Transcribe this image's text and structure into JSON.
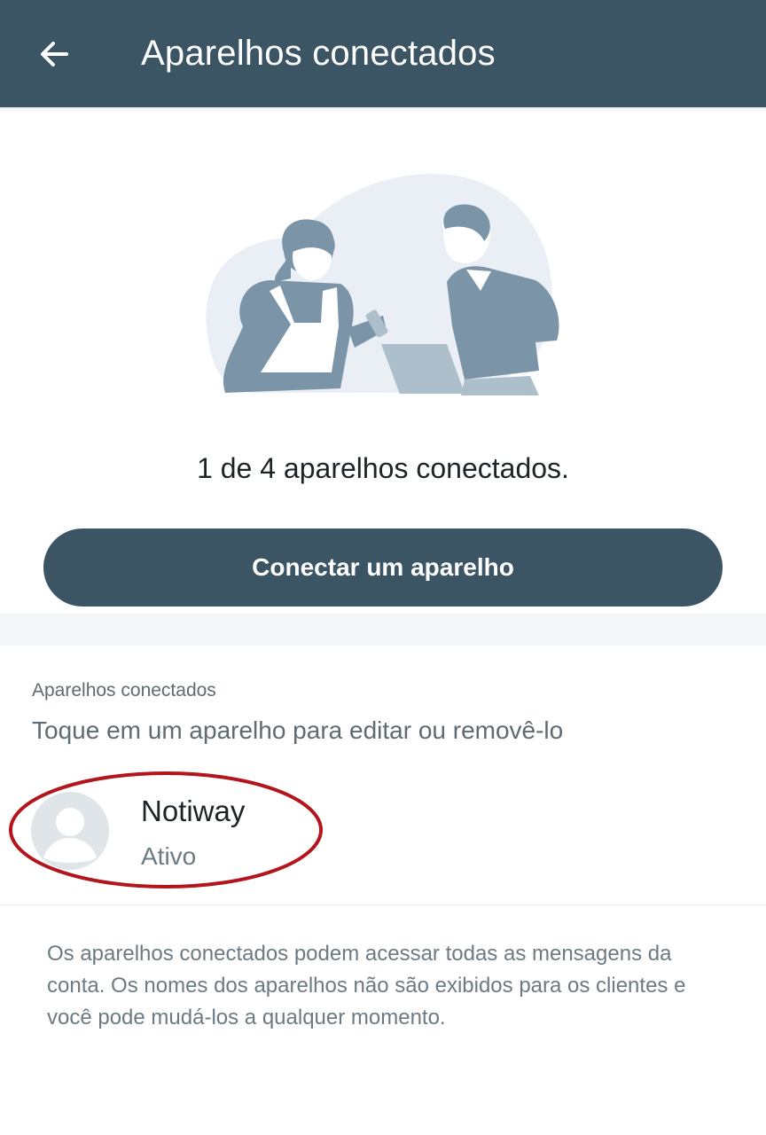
{
  "appbar": {
    "title": "Aparelhos conectados",
    "back_icon": "arrow-left-icon"
  },
  "hero": {
    "illustration": "two-people-with-phone-and-laptop-illustration"
  },
  "status": {
    "connected_text": "1 de 4 aparelhos conectados."
  },
  "actions": {
    "connect_label": "Conectar um aparelho"
  },
  "devices": {
    "section_label": "Aparelhos conectados",
    "hint": "Toque em um aparelho para editar ou removê-lo",
    "items": [
      {
        "name": "Notiway",
        "status": "Ativo",
        "avatar_icon": "default-avatar-icon"
      }
    ]
  },
  "footer": {
    "note": "Os aparelhos conectados podem acessar todas as mensagens da conta. Os nomes dos aparelhos não são exibidos para os clientes e você pode mudá-los a qualquer momento."
  },
  "colors": {
    "primary": "#3c5564",
    "highlight": "#b3151d",
    "illustration": "#7c94a8",
    "illustration_bg": "#e9eff5"
  }
}
